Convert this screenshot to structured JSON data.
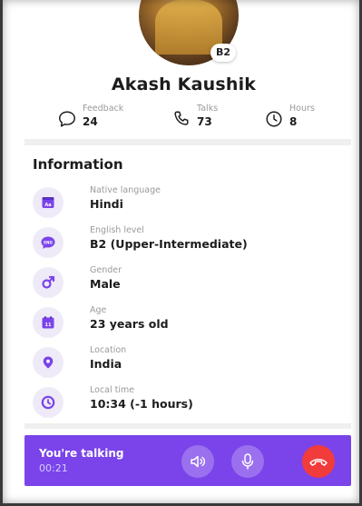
{
  "profile": {
    "name": "Akash Kaushik",
    "level_badge": "B2"
  },
  "stats": [
    {
      "icon": "chat-bubble-icon",
      "label": "Feedback",
      "value": "24"
    },
    {
      "icon": "phone-icon",
      "label": "Talks",
      "value": "73"
    },
    {
      "icon": "clock-icon",
      "label": "Hours",
      "value": "8"
    }
  ],
  "information": {
    "title": "Information",
    "rows": [
      {
        "icon": "language-icon",
        "label": "Native language",
        "value": "Hindi"
      },
      {
        "icon": "speech-bubble-icon",
        "label": "English level",
        "value": "B2 (Upper-Intermediate)"
      },
      {
        "icon": "gender-male-icon",
        "label": "Gender",
        "value": "Male"
      },
      {
        "icon": "calendar-icon",
        "label": "Age",
        "value": "23 years old"
      },
      {
        "icon": "location-pin-icon",
        "label": "Location",
        "value": "India"
      },
      {
        "icon": "clock-icon",
        "label": "Local time",
        "value": "10:34 (-1 hours)"
      }
    ]
  },
  "call": {
    "status": "You're talking",
    "duration": "00:21",
    "speaker_icon": "speaker-icon",
    "mic_icon": "microphone-icon",
    "hangup_icon": "hang-up-icon"
  },
  "colors": {
    "accent": "#7a44ea",
    "icon_bg": "#efeaf8",
    "hangup": "#f23b3b"
  }
}
